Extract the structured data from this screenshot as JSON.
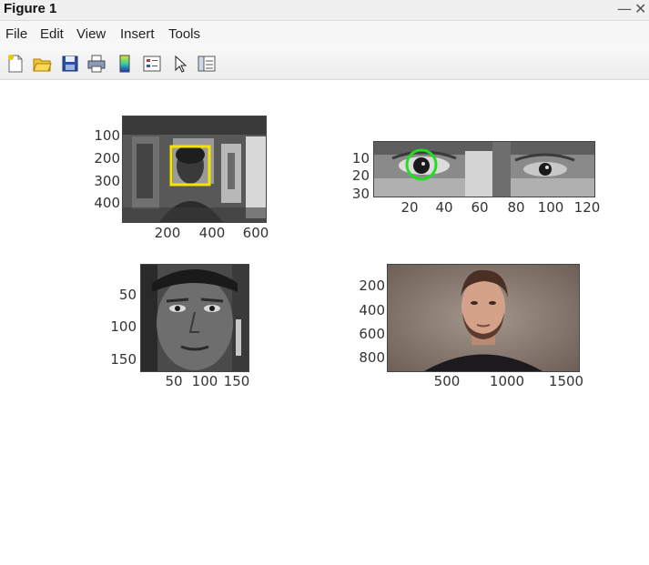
{
  "window": {
    "title": "Figure 1",
    "minimize_glyph": "—",
    "close_glyph": "✕"
  },
  "menu": [
    "File",
    "Edit",
    "View",
    "Insert",
    "Tools"
  ],
  "toolbar": {
    "icons": [
      "new-figure-icon",
      "open-file-icon",
      "save-icon",
      "print-icon",
      "colorbar-icon",
      "legend-icon",
      "pointer-icon",
      "property-editor-icon"
    ]
  },
  "subplots": {
    "top_left": {
      "content": "grayscale webcam frame with yellow face bounding box",
      "yticks": [
        "100",
        "200",
        "300",
        "400"
      ],
      "xticks": [
        "200",
        "400",
        "600"
      ],
      "box_color": "#f5e400"
    },
    "top_right": {
      "content": "grayscale eye region with green circle around detected eye",
      "yticks": [
        "10",
        "20",
        "30"
      ],
      "xticks": [
        "20",
        "40",
        "60",
        "80",
        "100",
        "120"
      ],
      "circle_color": "#22dd22"
    },
    "bottom_left": {
      "content": "cropped grayscale face",
      "yticks": [
        "50",
        "100",
        "150"
      ],
      "xticks": [
        "50",
        "100",
        "150"
      ]
    },
    "bottom_right": {
      "content": "color portrait photograph",
      "yticks": [
        "200",
        "400",
        "600",
        "800"
      ],
      "xticks": [
        "500",
        "1000",
        "1500"
      ]
    }
  }
}
